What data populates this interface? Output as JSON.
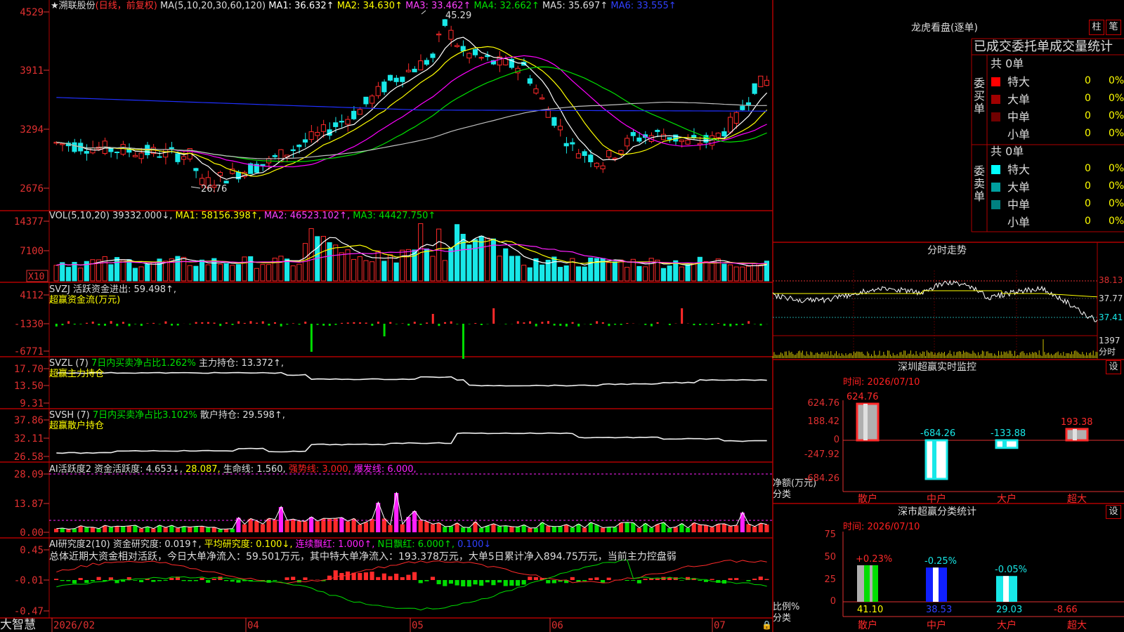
{
  "colors": {
    "up": "#ff2a2a",
    "down": "#18e8e8",
    "grid": "#b00000",
    "axis": "#e03030",
    "ma1": "#ffffff",
    "ma2": "#ffff00",
    "ma3": "#ff00ff",
    "ma4": "#00e000",
    "ma5": "#c0c0c0",
    "ma6": "#2030ff",
    "green": "#00dd00",
    "magenta": "#ff20ff",
    "yellow": "#ffff00"
  },
  "price_panel": {
    "title": "★溯联股份",
    "period": "(日线，前复权)",
    "ma_label": "MA(5,10,20,30,60,120)",
    "ma1": "MA1: 36.632↑",
    "ma2": "MA2: 34.630↑",
    "ma3": "MA3: 33.462↑",
    "ma4": "MA4: 32.662↑",
    "ma5": "MA5: 35.697↑",
    "ma6": "MA6: 33.555↑",
    "yticks": [
      "4529",
      "3911",
      "3294",
      "2676"
    ],
    "high_label": "45.29",
    "low_label": "26.76"
  },
  "vol_panel": {
    "label": "VOL(5,10,20) 39332.000↓,",
    "ma1": "MA1: 58156.398↑,",
    "ma2": "MA2: 46523.102↑,",
    "ma3": "MA3: 44427.750↑",
    "yticks": [
      "14377",
      "7100"
    ],
    "unit": "X10"
  },
  "svzj_panel": {
    "label": "SVZJ  活跃资金进出: 59.498↑,",
    "sub": "超赢资金流(万元)",
    "yticks": [
      "4112",
      "-1330",
      "-6771"
    ]
  },
  "svzl_panel": {
    "label": "SVZL (7)",
    "ratio": "7日内买卖净占比1.262%",
    "hold": "主力持仓: 13.372↑,",
    "sub": "超赢主力持仓",
    "yticks": [
      "17.70",
      "13.50",
      "9.31"
    ]
  },
  "svsh_panel": {
    "label": "SVSH (7)",
    "ratio": "7日内买卖净占比3.102%",
    "hold": "散户持仓: 29.598↑,",
    "sub": "超赢散户持仓",
    "yticks": [
      "37.86",
      "32.11",
      "26.58"
    ]
  },
  "ai_panel": {
    "label": "AI活跃度2 资金活跃度: 4.653↓,",
    "v2": "28.087,",
    "life": "生命线: 1.560,",
    "strong": "强势线: 3.000,",
    "burst": "爆发线: 6.000,",
    "yticks": [
      "28.09",
      "13.87",
      "0.00"
    ]
  },
  "ai_research": {
    "label": "AI研究度2(10) 资金研究度: 0.019↑,",
    "avg": "平均研究度: 0.100↓,",
    "red": "连续飘红: 1.000↑,",
    "n": "N日飘红: 6.000↑,",
    "v": "0.100↓",
    "summary": "总体近期大资金相对活跃，今日大单净流入：59.501万元，其中特大单净流入：193.378万元，大单5日累计净入894.75万元，当前主力控盘弱",
    "yticks": [
      "0.45",
      "-0.01",
      "-0.47"
    ]
  },
  "footer": {
    "brand": "大智慧",
    "dates": [
      "2026/02",
      "04",
      "05",
      "06",
      "07"
    ]
  },
  "dragon": {
    "title": "龙虎看盘(逐单)",
    "btn_zhu": "柱",
    "btn_bi": "笔",
    "subtitle": "已成交委托单成交量统计",
    "buy_label": "委买单",
    "sell_label": "委卖单",
    "buy_total": "共 0单",
    "sell_total": "共 0单",
    "buy_rows": [
      {
        "name": "特大",
        "count": "0",
        "pct": "0%",
        "color": "#ff0000"
      },
      {
        "name": "大单",
        "count": "0",
        "pct": "0%",
        "color": "#a00000"
      },
      {
        "name": "中单",
        "count": "0",
        "pct": "0%",
        "color": "#700000"
      },
      {
        "name": "小单",
        "count": "0",
        "pct": "0%",
        "color": "#000000"
      }
    ],
    "sell_rows": [
      {
        "name": "特大",
        "count": "0",
        "pct": "0%",
        "color": "#00ffff"
      },
      {
        "name": "大单",
        "count": "0",
        "pct": "0%",
        "color": "#00a0a0"
      },
      {
        "name": "中单",
        "count": "0",
        "pct": "0%",
        "color": "#008080"
      },
      {
        "name": "小单",
        "count": "0",
        "pct": "0%",
        "color": "#000000"
      }
    ]
  },
  "intraday": {
    "title": "分时走势",
    "prices": [
      "38.13",
      "37.77",
      "37.41"
    ],
    "vol": "1397",
    "unit": "分时"
  },
  "monitor": {
    "title": "深圳超赢实时监控",
    "set": "设",
    "time": "时间: 2026/07/10",
    "yticks": [
      "624.76",
      "188.42",
      "0",
      "-247.92",
      "-684.26"
    ],
    "unit1": "净额(万元)",
    "unit2": "分类",
    "cats": [
      "散户",
      "中户",
      "大户",
      "超大"
    ],
    "values": [
      624.76,
      -684.26,
      -133.88,
      193.38
    ],
    "value_labels": [
      "624.76",
      "-684.26",
      "-133.88",
      "193.38"
    ]
  },
  "classify": {
    "title": "深市超赢分类统计",
    "set": "设",
    "time": "时间: 2026/07/10",
    "yticks": [
      "75",
      "50",
      "25",
      "0"
    ],
    "unit1": "比例%",
    "unit2": "分类",
    "cats": [
      "散户",
      "中户",
      "大户",
      "超大"
    ],
    "pct_labels": [
      "+0.23%",
      "-0.25%",
      "-0.05%",
      ""
    ],
    "values": [
      41.1,
      38.53,
      29.03,
      -8.66
    ],
    "value_labels": [
      "41.10",
      "38.53",
      "29.03",
      "-8.66"
    ]
  }
}
